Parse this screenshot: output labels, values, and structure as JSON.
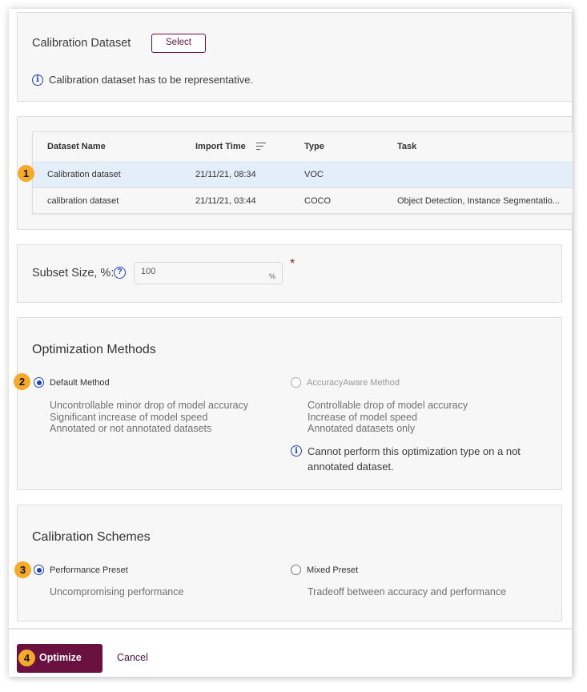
{
  "calibration_dataset": {
    "label": "Calibration Dataset",
    "select_button": "Select",
    "info_icon": "info-icon",
    "info_text": "Calibration dataset has to be representative."
  },
  "dataset_table": {
    "columns": [
      "Dataset Name",
      "Import Time",
      "Type",
      "Task"
    ],
    "sort_icon": "sort-icon",
    "rows": [
      {
        "name": "Calibration dataset",
        "import_time": "21/11/21, 08:34",
        "type": "VOC",
        "task": "",
        "selected": true
      },
      {
        "name": "calibration dataset",
        "import_time": "21/11/21, 03:44",
        "type": "COCO",
        "task": "Object Detection, Instance Segmentatio...",
        "selected": false
      }
    ]
  },
  "subset": {
    "label": "Subset Size, %:",
    "help_icon": "question-circle-icon",
    "value": "100",
    "unit": "%",
    "required_mark": "*"
  },
  "optimization_methods": {
    "title": "Optimization Methods",
    "options": [
      {
        "label": "Default Method",
        "checked": true,
        "disabled": false,
        "description": [
          "Uncontrollable minor drop of model accuracy",
          "Significant increase of model speed",
          "Annotated or not annotated datasets"
        ]
      },
      {
        "label": "AccuracyAware Method",
        "checked": false,
        "disabled": true,
        "description": [
          "Controllable drop of model accuracy",
          "Increase of model speed",
          "Annotated datasets only"
        ],
        "warning": "Cannot perform this optimization type on a not annotated dataset."
      }
    ]
  },
  "calibration_schemes": {
    "title": "Calibration Schemes",
    "options": [
      {
        "label": "Performance Preset",
        "checked": true,
        "description": "Uncompromising performance"
      },
      {
        "label": "Mixed Preset",
        "checked": false,
        "description": "Tradeoff between accuracy and performance"
      }
    ]
  },
  "footer": {
    "optimize_button": "Optimize",
    "cancel_button": "Cancel"
  },
  "step_badges": [
    "1",
    "2",
    "3",
    "4"
  ],
  "colors": {
    "brand": "#6b1140",
    "accent_blue": "#1e40c8",
    "badge": "#f7a928",
    "selected_row": "#e4eef9",
    "required": "#a0151e"
  }
}
